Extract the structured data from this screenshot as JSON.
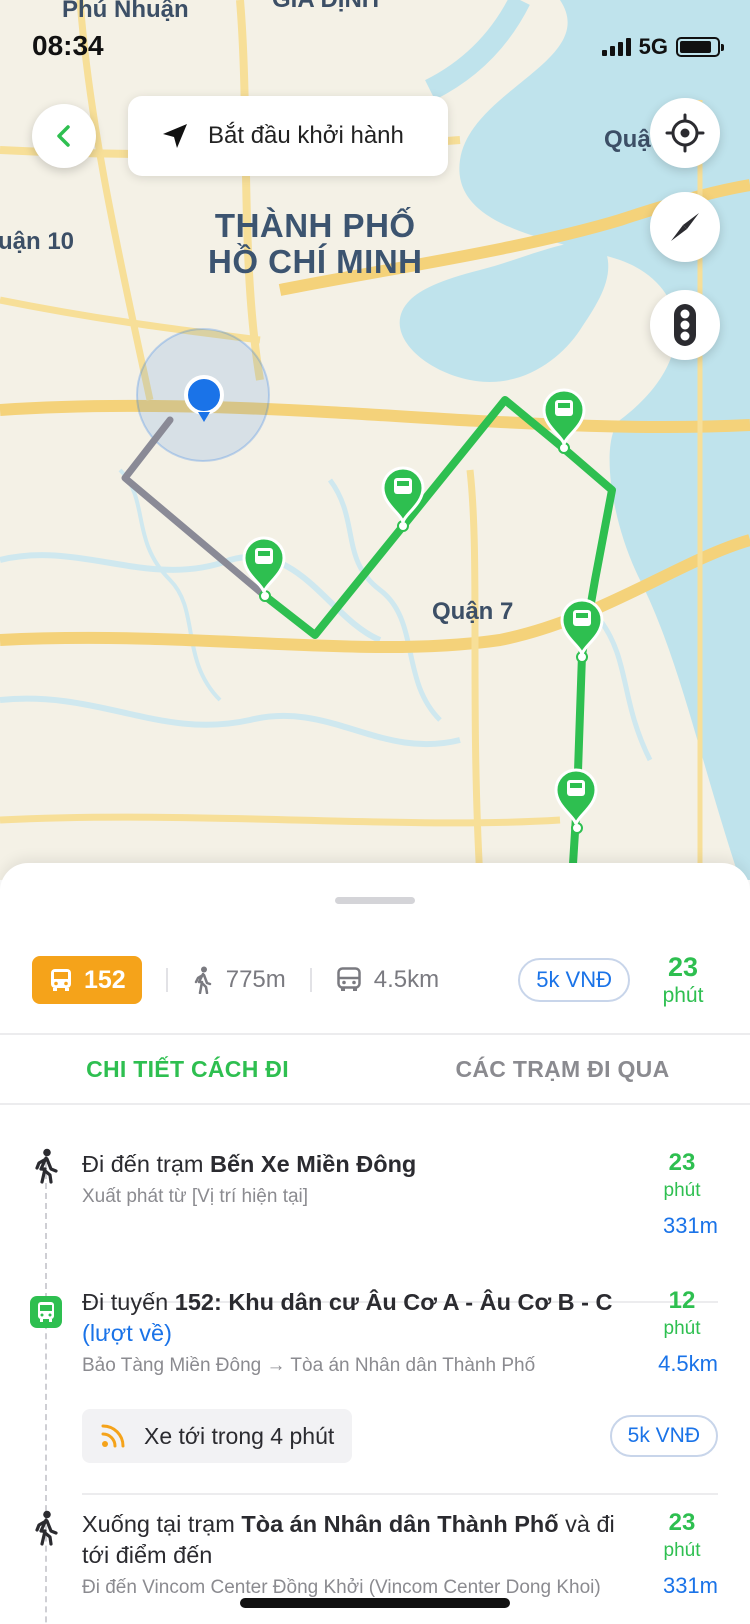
{
  "status_bar": {
    "time": "08:34",
    "network": "5G",
    "battery_level": 0.85
  },
  "map": {
    "labels": {
      "phu_nhuan": "Phú Nhuận",
      "gia_dinh": "GIA ĐỊNH",
      "city_line1": "THÀNH PHỐ",
      "city_line2": "HỒ CHÍ MINH",
      "quan10": "uận 10",
      "quan7": "Quận 7",
      "quan_right": "Quậ"
    },
    "colors": {
      "route": "#2ebf50",
      "walk": "#8a8a96",
      "river": "#bfe3ec",
      "road": "#f6d982",
      "user": "#1a73e8"
    }
  },
  "controls": {
    "start_label": "Bắt đầu khởi hành",
    "icons": [
      "back-chevron-icon",
      "navigation-arrow-icon",
      "locate-icon",
      "compass-icon",
      "traffic-light-icon"
    ]
  },
  "summary": {
    "route_number": "152",
    "walk_distance": "775m",
    "bus_distance": "4.5km",
    "price": "5k VNĐ",
    "total_time": "23",
    "time_unit": "phút"
  },
  "tabs": [
    {
      "label": "CHI TIẾT CÁCH ĐI",
      "active": true
    },
    {
      "label": "CÁC TRẠM ĐI QUA",
      "active": false
    }
  ],
  "steps": [
    {
      "type": "walk",
      "title_prefix": "Đi đến trạm ",
      "title_bold": "Bến Xe Miền Đông",
      "subtitle": "Xuất phát từ [Vị trí hiện tại]",
      "time": "23",
      "unit": "phút",
      "distance": "331m"
    },
    {
      "type": "bus",
      "title_prefix": "Đi tuyến ",
      "title_bold": "152: Khu dân cư Âu Cơ A - Âu Cơ B - C",
      "title_link": "(lượt về)",
      "subtitle": "Bảo Tàng Miền Đông → Tòa án Nhân dân Thành Phố",
      "time": "12",
      "unit": "phút",
      "distance": "4.5km",
      "arrival": "Xe tới trong 4 phút",
      "price": "5k VNĐ"
    },
    {
      "type": "walk",
      "title_prefix": "Xuống tại trạm ",
      "title_bold": "Tòa án Nhân dân Thành Phố",
      "title_suffix": " và đi tới điểm đến",
      "subtitle": "Đi đến Vincom Center Đồng Khởi (Vincom Center Dong Khoi)",
      "time": "23",
      "unit": "phút",
      "distance": "331m"
    }
  ]
}
